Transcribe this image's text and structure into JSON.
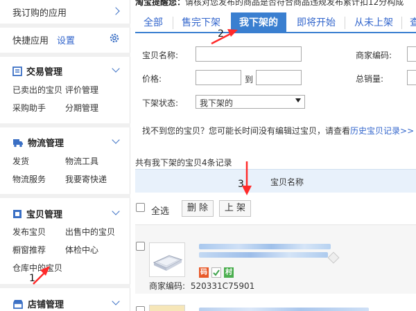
{
  "sidebar": {
    "my_apps": "我订购的应用",
    "quick_apps": "快捷应用",
    "settings_link": "设置",
    "sections": [
      {
        "title": "交易管理",
        "items": [
          "已卖出的宝贝",
          "评价管理",
          "采购助手",
          "分期管理"
        ]
      },
      {
        "title": "物流管理",
        "items": [
          "发货",
          "物流工具",
          "物流服务",
          "我要寄快递"
        ]
      },
      {
        "title": "宝贝管理",
        "items": [
          "发布宝贝",
          "出售中的宝贝",
          "橱窗推荐",
          "体检中心",
          "仓库中的宝贝"
        ]
      },
      {
        "title": "店铺管理",
        "items": []
      }
    ]
  },
  "notice": {
    "label": "淘宝提醒您：",
    "text": "请核对您发布的商品是否符合商品违规发布累计扣12分构成"
  },
  "tabs": [
    {
      "label": "全部"
    },
    {
      "label": "售完下架"
    },
    {
      "label": "我下架的",
      "active": true
    },
    {
      "label": "即将开始"
    },
    {
      "label": "从未上架"
    },
    {
      "label": "查"
    }
  ],
  "filters": {
    "name_label": "宝贝名称:",
    "merchant_code_label": "商家编码:",
    "price_label": "价格:",
    "to_label": "到",
    "total_sales_label": "总销量:",
    "status_label": "下架状态:",
    "status_selected": "我下架的"
  },
  "hint": {
    "text": "找不到您的宝贝？您可能长时间没有编辑过宝贝，请查看",
    "link": "历史宝贝记录>>"
  },
  "list": {
    "count_text": "共有我下架的宝贝4条记录",
    "col_name": "宝贝名称",
    "select_all": "全选",
    "delete_btn": "删 除",
    "list_btn": "上 架",
    "item": {
      "badges": [
        "码",
        "",
        "村"
      ],
      "merchant_code_label": "商家编码:",
      "merchant_code": "520331C75901"
    }
  },
  "annotations": [
    "1",
    "2",
    "3"
  ],
  "colors": {
    "accent": "#3a7fd0",
    "link": "#3366cc",
    "arrow": "#ff2a2a"
  }
}
